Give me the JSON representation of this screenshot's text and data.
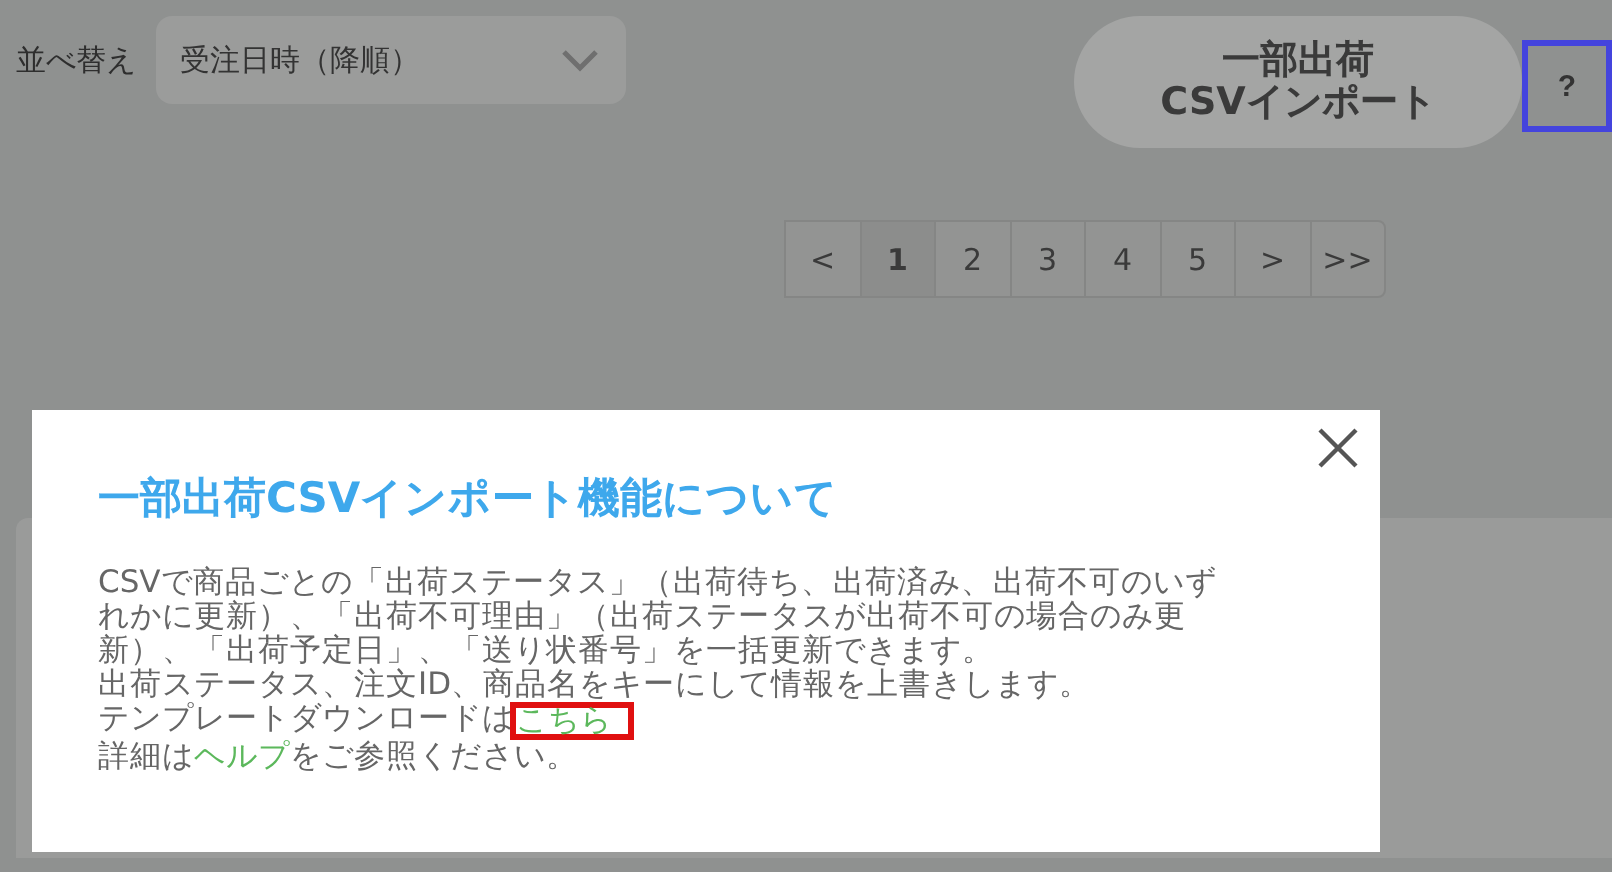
{
  "toolbar": {
    "sort_label": "並べ替え",
    "sort_value": "受注日時（降順）",
    "import_button": "一部出荷\nCSVインポート",
    "help_button": {
      "label": "?",
      "highlighted": true
    }
  },
  "pagination": [
    {
      "label": "<",
      "selected": false
    },
    {
      "label": "1",
      "selected": true
    },
    {
      "label": "2",
      "selected": false
    },
    {
      "label": "3",
      "selected": false
    },
    {
      "label": "4",
      "selected": false
    },
    {
      "label": "5",
      "selected": false
    },
    {
      "label": ">",
      "selected": false
    },
    {
      "label": ">>",
      "selected": false
    }
  ],
  "modal": {
    "title": "一部出荷CSVインポート機能について",
    "description": "CSVで商品ごとの「出荷ステータス」（出荷待ち、出荷済み、出荷不可のいずれかに更新）、「出荷不可理由」（出荷ステータスが出荷不可の場合のみ更新）、「出荷予定日」、「送り状番号」を一括更新できます。",
    "note": "出荷ステータス、注文ID、商品名をキーにして情報を上書きします。",
    "template_line": {
      "text": "テンプレートダウンロードは",
      "link": "こちら",
      "highlighted": true
    },
    "help_line": {
      "before": "詳細は",
      "link": "ヘルプ",
      "after": "をご参照ください。"
    }
  }
}
